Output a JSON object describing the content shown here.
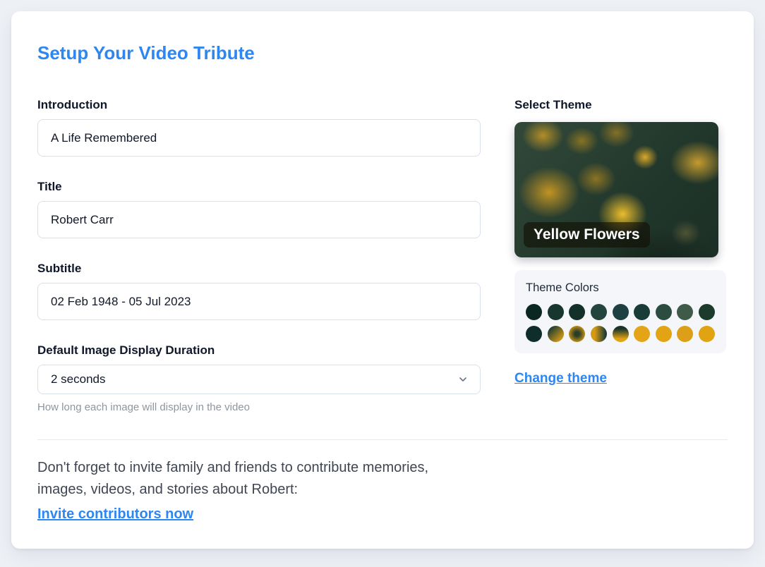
{
  "page": {
    "title": "Setup Your Video Tribute"
  },
  "form": {
    "introduction": {
      "label": "Introduction",
      "value": "A Life Remembered"
    },
    "title": {
      "label": "Title",
      "value": "Robert Carr"
    },
    "subtitle": {
      "label": "Subtitle",
      "value": "02 Feb 1948 - 05 Jul 2023"
    },
    "duration": {
      "label": "Default Image Display Duration",
      "selected_value": "2 seconds",
      "help": "How long each image will display in the video"
    }
  },
  "theme": {
    "section_label": "Select Theme",
    "name": "Yellow Flowers",
    "colors_label": "Theme Colors",
    "swatches_row1": [
      "#0b2722",
      "#16362e",
      "#143129",
      "#24453c",
      "#1d4043",
      "#1a3c38",
      "#2b4c3e",
      "#3f5a48",
      "#1d3b2c"
    ],
    "swatches_row2": [
      "#0e2d2b",
      "linear-gradient(135deg,#1c3b33 15%,#d49a16 85%)",
      "radial-gradient(circle at 50% 50%,#2a3d28 20%,#d49a16 78%)",
      "linear-gradient(90deg,#d49a16 25%,#1c3b33 92%)",
      "linear-gradient(180deg,#17332c 18%,#e0a312 80%)",
      "#e4a416",
      "#e2a315",
      "#dd9f17",
      "#e0a312"
    ],
    "change_link": "Change theme"
  },
  "invite": {
    "text": "Don't forget to invite family and friends to contribute memories, images, videos, and stories about Robert:",
    "link": "Invite contributors now"
  },
  "colors": {
    "accent_blue": "#2e86f0",
    "page_background": "#edf0f5",
    "panel_background": "#f4f6f9"
  }
}
